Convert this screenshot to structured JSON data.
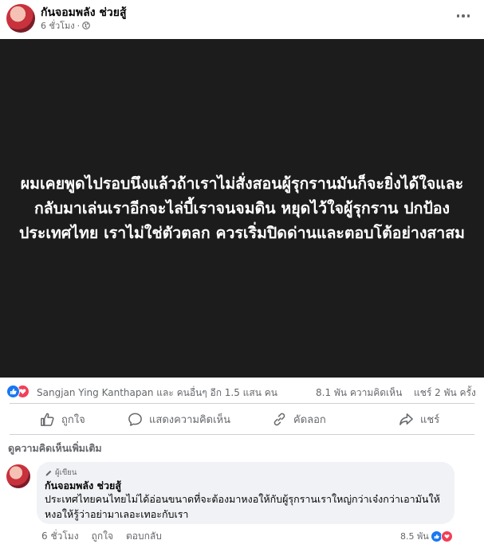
{
  "post": {
    "page_name": "กันจอมพลัง ช่วยสู้",
    "time": "6 ชั่วโมง",
    "privacy_separator": "·",
    "image_text": "ผมเคยพูดไปรอบนึงแล้วถ้าเราไม่สั่งสอนผู้รุกรานมันก็จะยิ่งได้ใจและกลับมาเล่นเราอีกจะไล่บี้เราจนจมดิน หยุดไว้ใจผู้รุกราน ปกป้องประเทศไทย เราไม่ใช่ตัวตลก ควรเริ่มปิดด่านและตอบโต้อย่างสาสม"
  },
  "reactions": {
    "names": "Sangjan Ying Kanthapan และ คนอื่นๆ อีก 1.5 แสน คน",
    "comments": "8.1 พัน ความคิดเห็น",
    "shares": "แชร์ 2 พัน ครั้ง"
  },
  "actions": {
    "like": "ถูกใจ",
    "comment": "แสดงความคิดเห็น",
    "copy": "คัดลอก",
    "share": "แชร์"
  },
  "comments": {
    "more_label": "ดูความคิดเห็นเพิ่มเติม",
    "items": [
      {
        "badge": "ผู้เขียน",
        "author": "กันจอมพลัง ช่วยสู้",
        "text": "ประเทศไทยคนไทยไม่ได้อ่อนขนาดที่จะต้องมาหงอให้กับผู้รุกรานเราใหญ่กว่าเจ๋งกว่าเอามันให้หงอให้รู้ว่าอย่ามาเลอะเทอะกับเรา",
        "time": "6 ชั่วโมง",
        "like_label": "ถูกใจ",
        "reply_label": "ตอบกลับ",
        "reaction_count": "8.5 พัน"
      }
    ]
  },
  "colors": {
    "like_blue": "#1877f2",
    "love_red": "#f33e58",
    "muted_text": "#65676b",
    "image_bg": "#1c1c1c"
  },
  "icons": [
    "globe-icon",
    "more-icon",
    "like-reaction-icon",
    "love-reaction-icon",
    "thumbs-up-icon",
    "comment-icon",
    "copy-link-icon",
    "share-icon",
    "author-badge-icon"
  ]
}
